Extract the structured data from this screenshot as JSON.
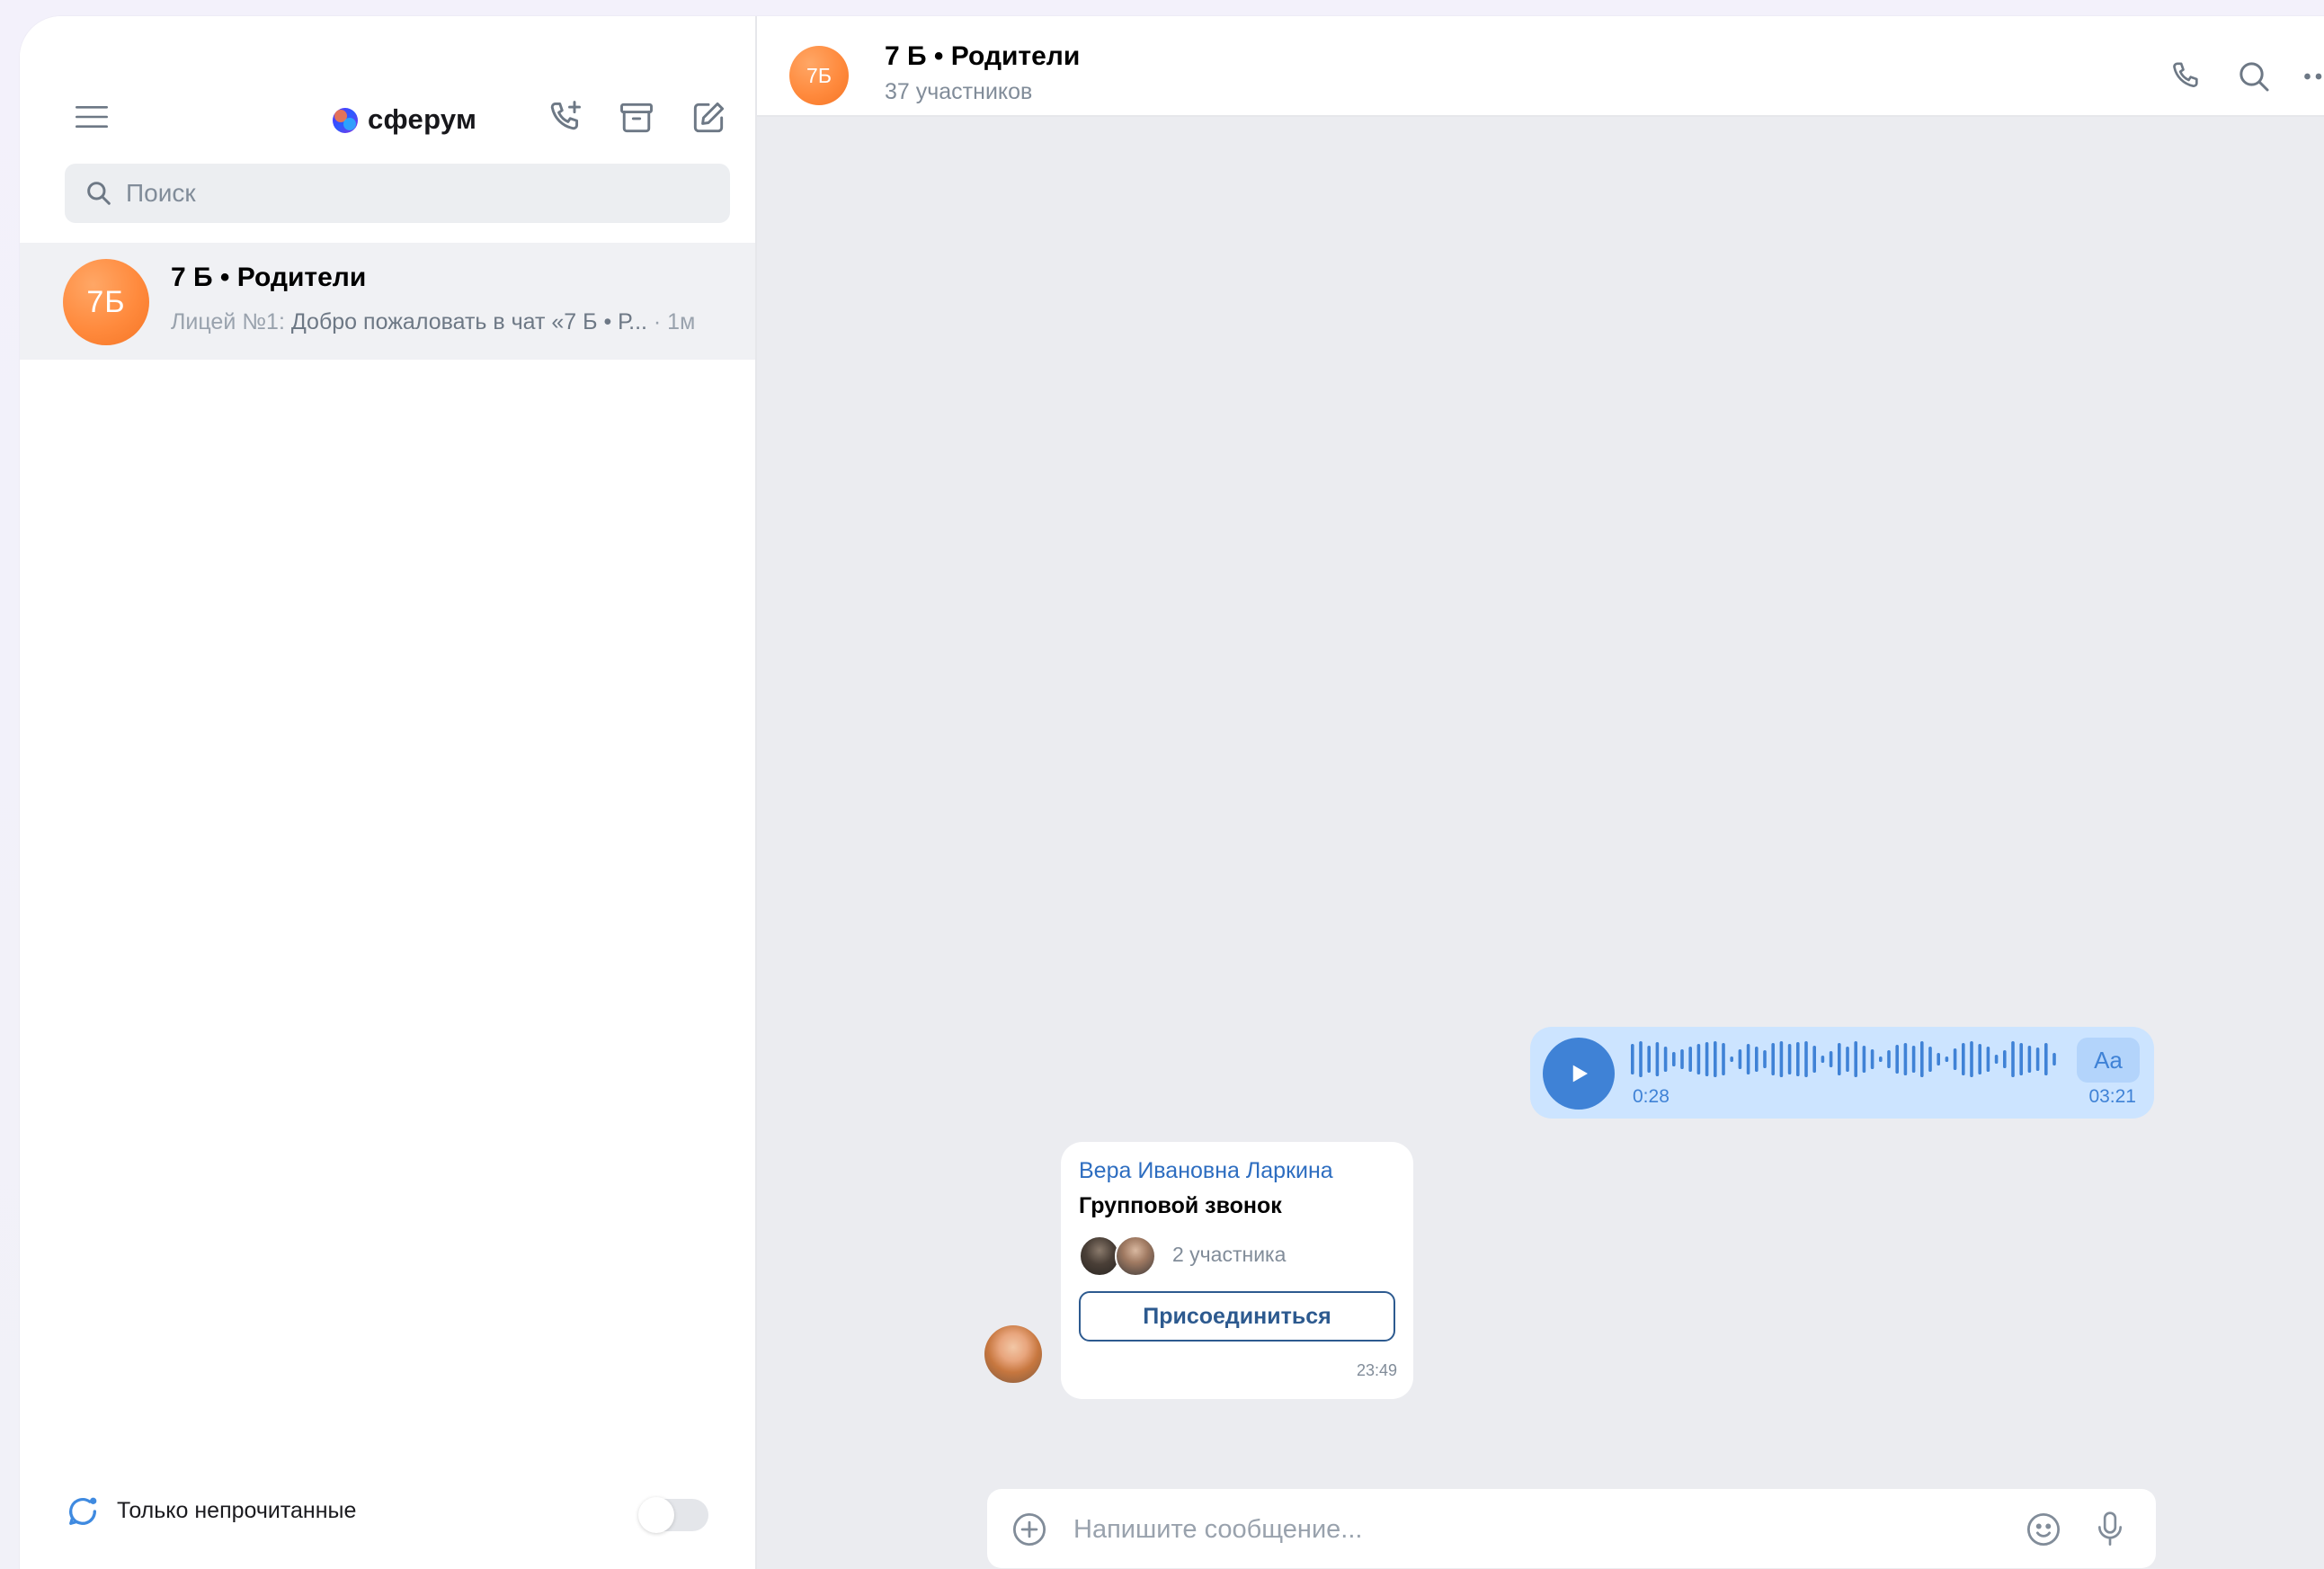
{
  "app": {
    "logo_text": "сферум"
  },
  "sidebar": {
    "search_placeholder": "Поиск",
    "chats": [
      {
        "avatar_text": "7Б",
        "title": "7 Б • Родители",
        "preview_sender": "Лицей №1: ",
        "preview_text": "Добро пожаловать в чат «7 Б • Р...",
        "preview_time": " · 1м"
      }
    ],
    "footer": {
      "unread_only_label": "Только непрочитанные",
      "unread_only_enabled": false
    }
  },
  "chat": {
    "avatar_text": "7Б",
    "title": "7 Б • Родители",
    "subtitle": "37 участников",
    "voice_message": {
      "elapsed": "0:28",
      "sent_time": "03:21",
      "transcribe_label": "Aa"
    },
    "call_message": {
      "sender": "Вера Ивановна Ларкина",
      "title": "Групповой звонок",
      "participants_label": "2 участника",
      "join_label": "Присоединиться",
      "time": "23:49"
    },
    "composer": {
      "placeholder": "Напишите сообщение..."
    }
  },
  "colors": {
    "accent": "#3f82d6",
    "avatar_orange": "#ff8a3d",
    "voice_bubble": "#cce4ff",
    "chat_background": "#ebecf0"
  },
  "icons": {
    "menu": "hamburger-icon",
    "new_call": "phone-plus-icon",
    "archive": "archive-icon",
    "compose": "edit-icon",
    "search": "search-icon",
    "call": "phone-icon",
    "more": "more-horizontal-icon",
    "play": "play-icon",
    "attach": "plus-circle-icon",
    "emoji": "smile-icon",
    "mic": "microphone-icon",
    "unread": "chat-bubble-icon"
  }
}
